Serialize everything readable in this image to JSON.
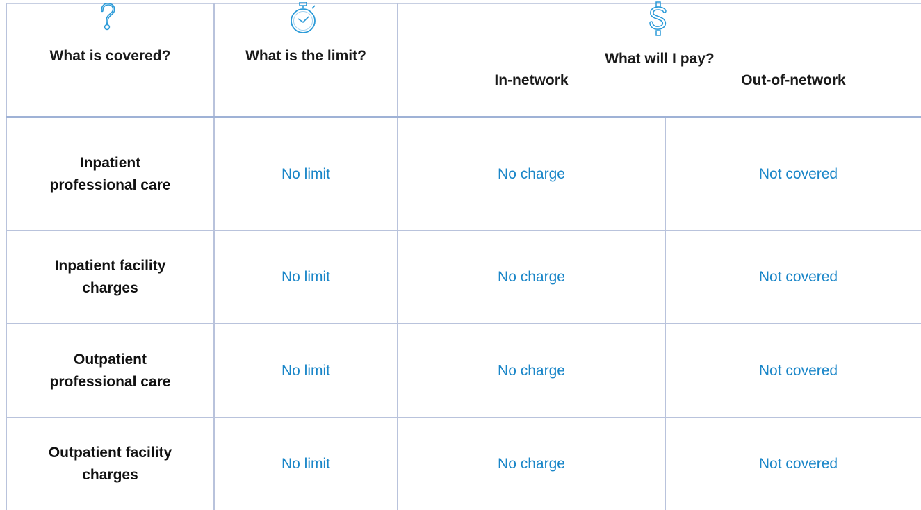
{
  "header": {
    "col1": "What is covered?",
    "col2": "What is the limit?",
    "col3": "What will I pay?",
    "sub_in": "In-network",
    "sub_out": "Out-of-network"
  },
  "icons": {
    "col1": "question-mark-icon",
    "col2": "stopwatch-icon",
    "col3": "dollar-sign-icon"
  },
  "colors": {
    "accent": "#1a86c8",
    "grid": "#b9c3dc"
  },
  "rows": [
    {
      "label_1": "Inpatient",
      "label_2": "professional care",
      "limit": "No limit",
      "in_network": "No charge",
      "out_network": "Not covered"
    },
    {
      "label_1": "Inpatient facility",
      "label_2": "charges",
      "limit": "No limit",
      "in_network": "No charge",
      "out_network": "Not covered"
    },
    {
      "label_1": "Outpatient",
      "label_2": "professional care",
      "limit": "No limit",
      "in_network": "No charge",
      "out_network": "Not covered"
    },
    {
      "label_1": "Outpatient facility",
      "label_2": "charges",
      "limit": "No limit",
      "in_network": "No charge",
      "out_network": "Not covered"
    }
  ]
}
